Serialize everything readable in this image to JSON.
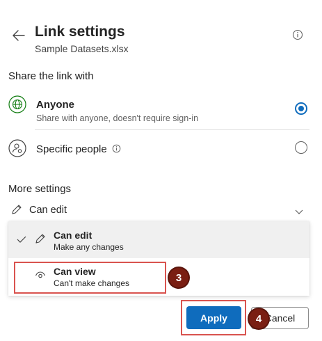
{
  "header": {
    "title": "Link settings",
    "subtitle": "Sample Datasets.xlsx",
    "back_icon": "arrow-left-icon",
    "info_icon": "info-icon"
  },
  "share": {
    "label": "Share the link with",
    "options": [
      {
        "title": "Anyone",
        "description": "Share with anyone, doesn't require sign-in",
        "icon": "globe-icon",
        "selected": true
      },
      {
        "title": "Specific people",
        "icon": "people-settings-icon",
        "selected": false
      }
    ]
  },
  "more_settings": {
    "label": "More settings",
    "permission": {
      "current": "Can edit",
      "icon": "pencil-icon",
      "options": [
        {
          "title": "Can edit",
          "description": "Make any changes",
          "icon": "pencil-icon",
          "selected": true
        },
        {
          "title": "Can view",
          "description": "Can't make changes",
          "icon": "eye-icon",
          "selected": false
        }
      ]
    }
  },
  "annotations": {
    "step_view": "3",
    "step_apply": "4"
  },
  "footer": {
    "apply_label": "Apply",
    "cancel_label": "Cancel"
  },
  "colors": {
    "accent": "#0f6cbd",
    "highlight_border": "#d9534f",
    "badge": "#7a1e12"
  }
}
